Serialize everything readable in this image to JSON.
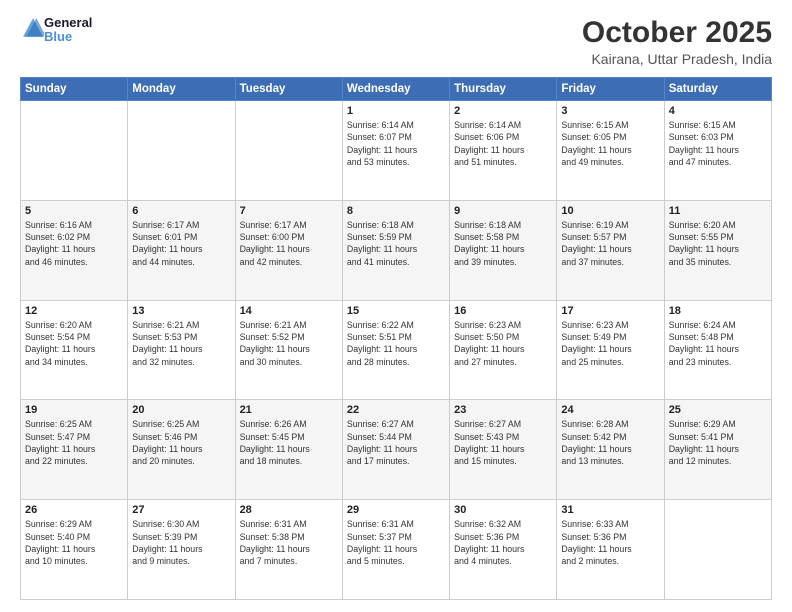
{
  "header": {
    "logo_line1": "General",
    "logo_line2": "Blue",
    "main_title": "October 2025",
    "sub_title": "Kairana, Uttar Pradesh, India"
  },
  "days_of_week": [
    "Sunday",
    "Monday",
    "Tuesday",
    "Wednesday",
    "Thursday",
    "Friday",
    "Saturday"
  ],
  "weeks": [
    [
      {
        "day": "",
        "info": ""
      },
      {
        "day": "",
        "info": ""
      },
      {
        "day": "",
        "info": ""
      },
      {
        "day": "1",
        "info": "Sunrise: 6:14 AM\nSunset: 6:07 PM\nDaylight: 11 hours\nand 53 minutes."
      },
      {
        "day": "2",
        "info": "Sunrise: 6:14 AM\nSunset: 6:06 PM\nDaylight: 11 hours\nand 51 minutes."
      },
      {
        "day": "3",
        "info": "Sunrise: 6:15 AM\nSunset: 6:05 PM\nDaylight: 11 hours\nand 49 minutes."
      },
      {
        "day": "4",
        "info": "Sunrise: 6:15 AM\nSunset: 6:03 PM\nDaylight: 11 hours\nand 47 minutes."
      }
    ],
    [
      {
        "day": "5",
        "info": "Sunrise: 6:16 AM\nSunset: 6:02 PM\nDaylight: 11 hours\nand 46 minutes."
      },
      {
        "day": "6",
        "info": "Sunrise: 6:17 AM\nSunset: 6:01 PM\nDaylight: 11 hours\nand 44 minutes."
      },
      {
        "day": "7",
        "info": "Sunrise: 6:17 AM\nSunset: 6:00 PM\nDaylight: 11 hours\nand 42 minutes."
      },
      {
        "day": "8",
        "info": "Sunrise: 6:18 AM\nSunset: 5:59 PM\nDaylight: 11 hours\nand 41 minutes."
      },
      {
        "day": "9",
        "info": "Sunrise: 6:18 AM\nSunset: 5:58 PM\nDaylight: 11 hours\nand 39 minutes."
      },
      {
        "day": "10",
        "info": "Sunrise: 6:19 AM\nSunset: 5:57 PM\nDaylight: 11 hours\nand 37 minutes."
      },
      {
        "day": "11",
        "info": "Sunrise: 6:20 AM\nSunset: 5:55 PM\nDaylight: 11 hours\nand 35 minutes."
      }
    ],
    [
      {
        "day": "12",
        "info": "Sunrise: 6:20 AM\nSunset: 5:54 PM\nDaylight: 11 hours\nand 34 minutes."
      },
      {
        "day": "13",
        "info": "Sunrise: 6:21 AM\nSunset: 5:53 PM\nDaylight: 11 hours\nand 32 minutes."
      },
      {
        "day": "14",
        "info": "Sunrise: 6:21 AM\nSunset: 5:52 PM\nDaylight: 11 hours\nand 30 minutes."
      },
      {
        "day": "15",
        "info": "Sunrise: 6:22 AM\nSunset: 5:51 PM\nDaylight: 11 hours\nand 28 minutes."
      },
      {
        "day": "16",
        "info": "Sunrise: 6:23 AM\nSunset: 5:50 PM\nDaylight: 11 hours\nand 27 minutes."
      },
      {
        "day": "17",
        "info": "Sunrise: 6:23 AM\nSunset: 5:49 PM\nDaylight: 11 hours\nand 25 minutes."
      },
      {
        "day": "18",
        "info": "Sunrise: 6:24 AM\nSunset: 5:48 PM\nDaylight: 11 hours\nand 23 minutes."
      }
    ],
    [
      {
        "day": "19",
        "info": "Sunrise: 6:25 AM\nSunset: 5:47 PM\nDaylight: 11 hours\nand 22 minutes."
      },
      {
        "day": "20",
        "info": "Sunrise: 6:25 AM\nSunset: 5:46 PM\nDaylight: 11 hours\nand 20 minutes."
      },
      {
        "day": "21",
        "info": "Sunrise: 6:26 AM\nSunset: 5:45 PM\nDaylight: 11 hours\nand 18 minutes."
      },
      {
        "day": "22",
        "info": "Sunrise: 6:27 AM\nSunset: 5:44 PM\nDaylight: 11 hours\nand 17 minutes."
      },
      {
        "day": "23",
        "info": "Sunrise: 6:27 AM\nSunset: 5:43 PM\nDaylight: 11 hours\nand 15 minutes."
      },
      {
        "day": "24",
        "info": "Sunrise: 6:28 AM\nSunset: 5:42 PM\nDaylight: 11 hours\nand 13 minutes."
      },
      {
        "day": "25",
        "info": "Sunrise: 6:29 AM\nSunset: 5:41 PM\nDaylight: 11 hours\nand 12 minutes."
      }
    ],
    [
      {
        "day": "26",
        "info": "Sunrise: 6:29 AM\nSunset: 5:40 PM\nDaylight: 11 hours\nand 10 minutes."
      },
      {
        "day": "27",
        "info": "Sunrise: 6:30 AM\nSunset: 5:39 PM\nDaylight: 11 hours\nand 9 minutes."
      },
      {
        "day": "28",
        "info": "Sunrise: 6:31 AM\nSunset: 5:38 PM\nDaylight: 11 hours\nand 7 minutes."
      },
      {
        "day": "29",
        "info": "Sunrise: 6:31 AM\nSunset: 5:37 PM\nDaylight: 11 hours\nand 5 minutes."
      },
      {
        "day": "30",
        "info": "Sunrise: 6:32 AM\nSunset: 5:36 PM\nDaylight: 11 hours\nand 4 minutes."
      },
      {
        "day": "31",
        "info": "Sunrise: 6:33 AM\nSunset: 5:36 PM\nDaylight: 11 hours\nand 2 minutes."
      },
      {
        "day": "",
        "info": ""
      }
    ]
  ]
}
